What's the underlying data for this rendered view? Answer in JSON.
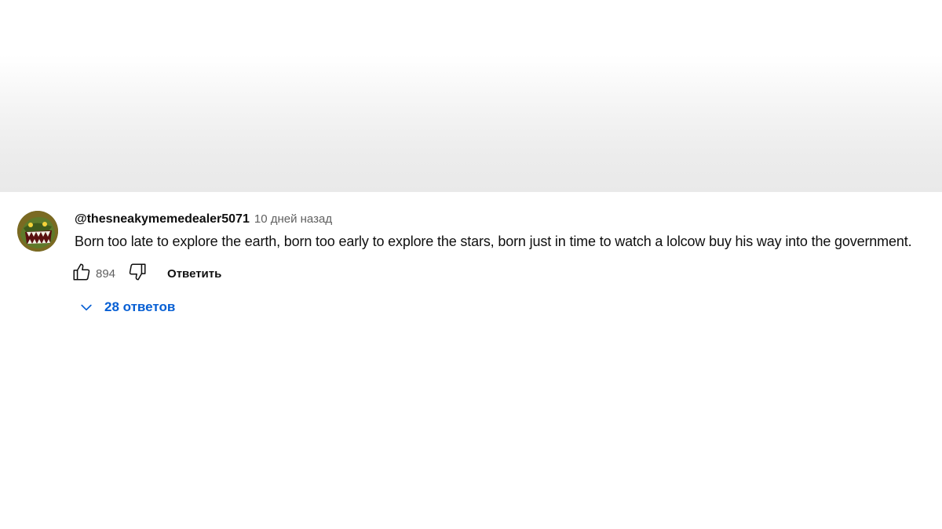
{
  "comment": {
    "author": "@thesneakymemedealer5071",
    "timestamp": "10 дней назад",
    "text": "Born too late to explore the earth, born too early to explore the stars, born just in time to watch a lolcow buy his way into the government.",
    "like_count": "894",
    "reply_label": "Ответить",
    "replies_label": "28 ответов"
  },
  "icons": {
    "like": "thumbs-up-icon",
    "dislike": "thumbs-down-icon",
    "expand": "chevron-down-icon",
    "avatar": "avatar"
  },
  "colors": {
    "text": "#0f0f0f",
    "secondary_text": "#606060",
    "link_blue": "#065fd4",
    "header_shade": "#e9e9e9"
  }
}
